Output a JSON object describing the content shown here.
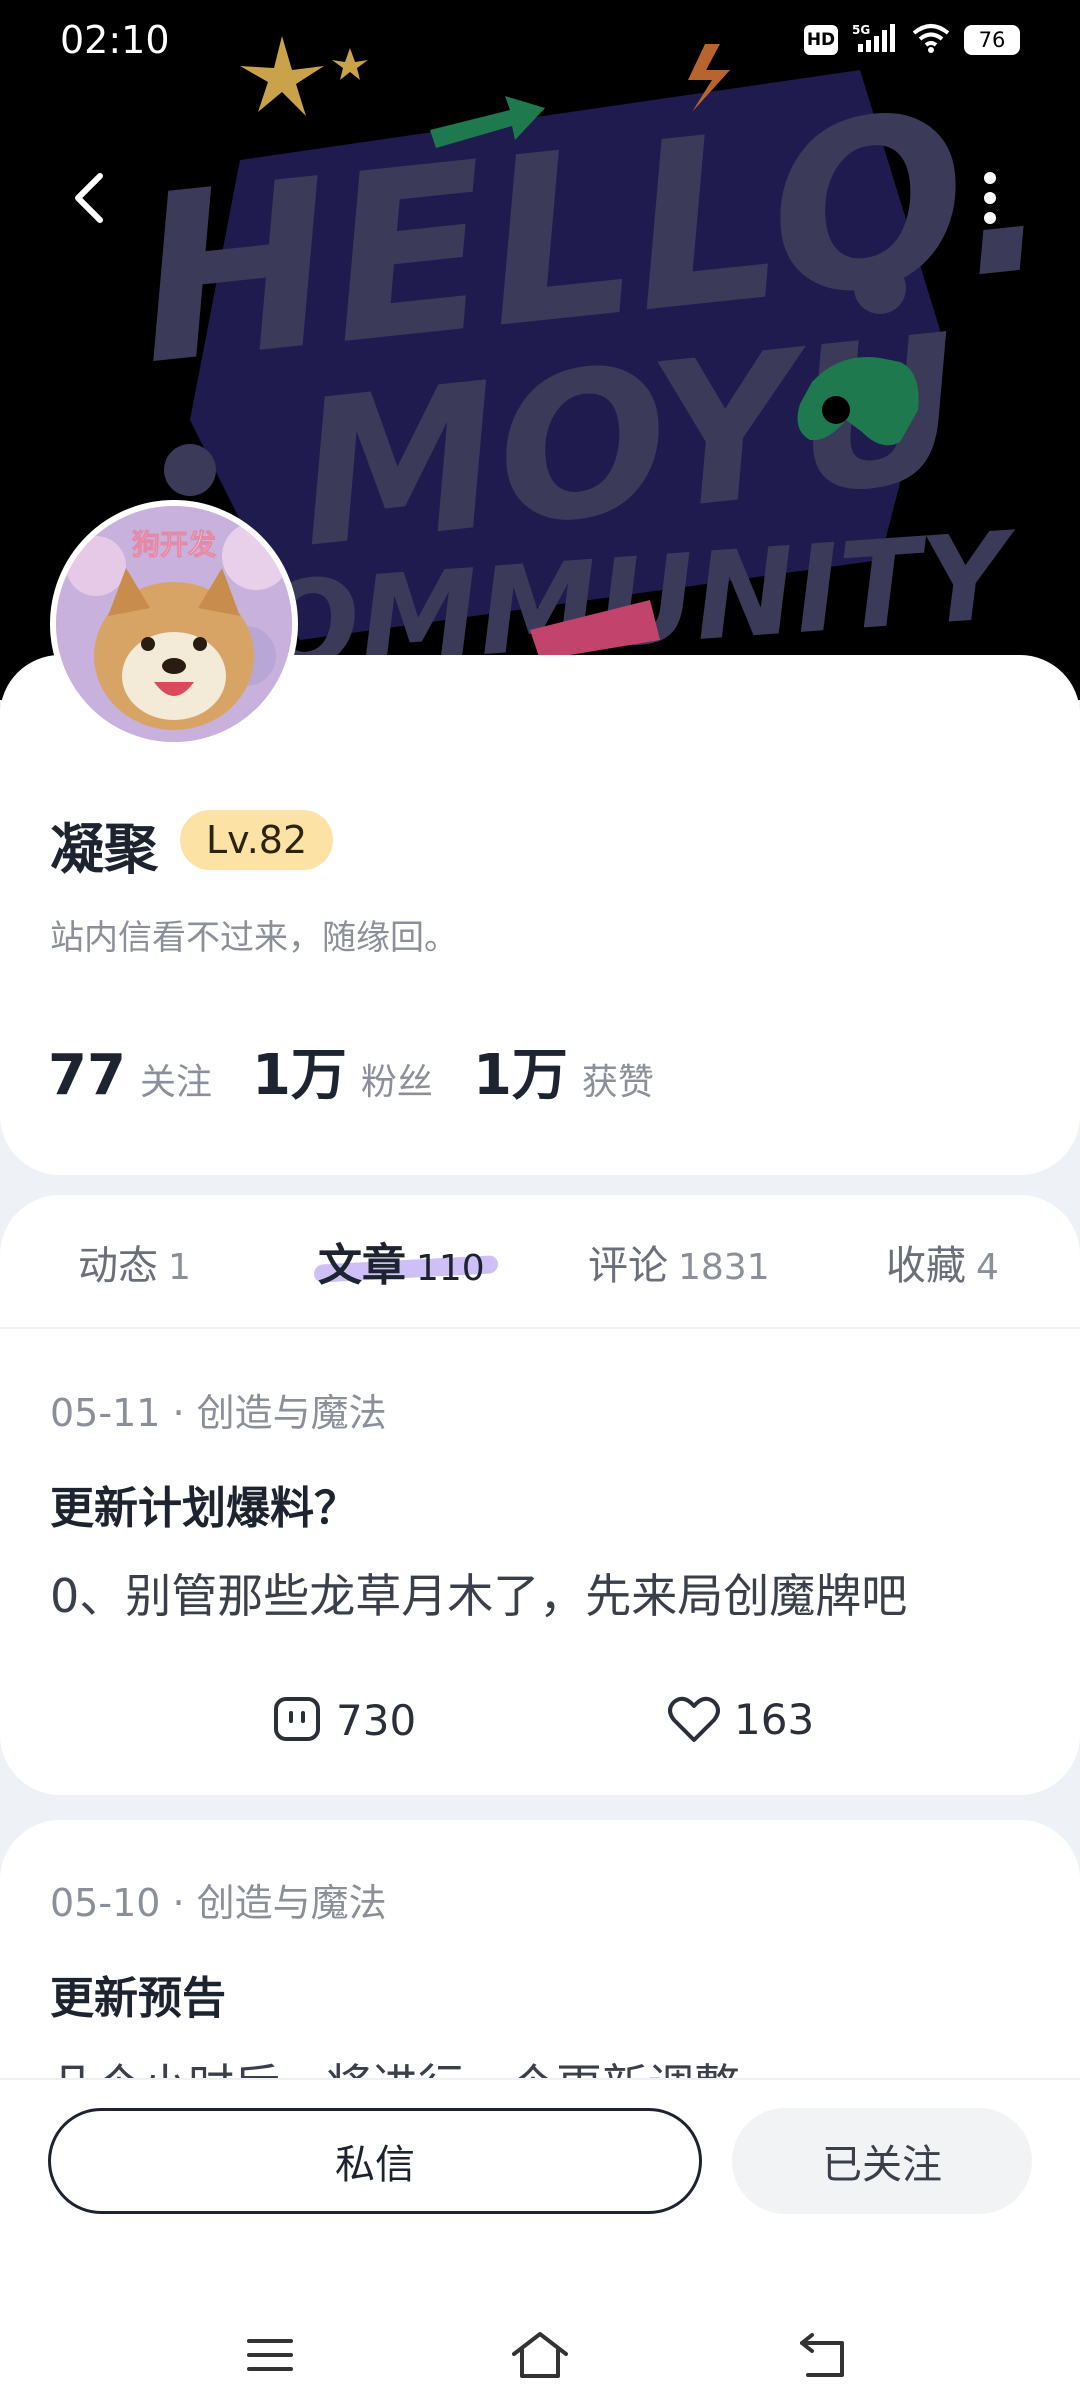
{
  "status_bar": {
    "time": "02:10",
    "hd": "HD",
    "network": "5G",
    "battery": "76"
  },
  "banner": {
    "line1": "HELLO.",
    "line2": "MOYU",
    "line3": "COMMUNITY"
  },
  "avatar": {
    "caption": "狗开发"
  },
  "profile": {
    "name": "凝聚",
    "level": "Lv.82",
    "bio": "站内信看不过来，随缘回。",
    "stats": [
      {
        "value": "77",
        "label": "关注"
      },
      {
        "value": "1万",
        "label": "粉丝"
      },
      {
        "value": "1万",
        "label": "获赞"
      }
    ]
  },
  "tabs": [
    {
      "label": "动态",
      "count": "1"
    },
    {
      "label": "文章",
      "count": "110"
    },
    {
      "label": "评论",
      "count": "1831"
    },
    {
      "label": "收藏",
      "count": "4"
    }
  ],
  "posts": [
    {
      "meta": "05-11 · 创造与魔法",
      "title": "更新计划爆料？",
      "excerpt": "0、别管那些龙草月木了，先来局创魔牌吧",
      "comments": "730",
      "likes": "163"
    },
    {
      "meta": "05-10 · 创造与魔法",
      "title": "更新预告",
      "excerpt": "几个小时后，将进行一个更新调整"
    }
  ],
  "actions": {
    "message": "私信",
    "follow": "已关注"
  },
  "colors": {
    "accent_underline": "#c9b8f5",
    "level_badge": "#fde2a6",
    "text_primary": "#1e2330",
    "text_secondary": "#8a8f99"
  }
}
